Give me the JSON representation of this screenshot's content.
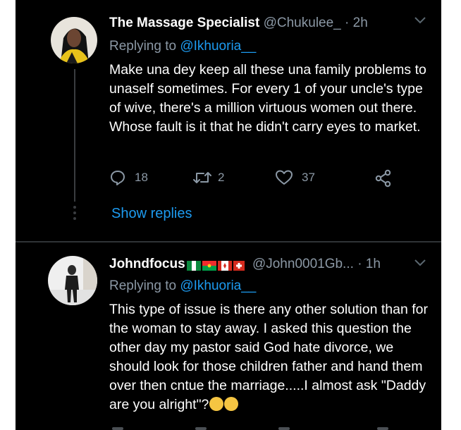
{
  "tweets": [
    {
      "display_name": "The Massage Specialist",
      "handle": "@Chukulee_",
      "time": "· 2h",
      "replying_prefix": "Replying to",
      "replying_to": "@Ikhuoria__",
      "text": "Make una dey keep all these una family problems to unaself sometimes. For every 1 of your uncle's type of wive, there's a million virtuous women out there. Whose fault is it that he didn't carry eyes to market.",
      "replies": "18",
      "retweets": "2",
      "likes": "37",
      "show_replies": "Show replies"
    },
    {
      "display_name": "Johndfocus",
      "handle": "@John0001Gb...",
      "time": "· 1h",
      "replying_prefix": "Replying to",
      "replying_to": "@Ikhuoria__",
      "text": "This type of issue is there any other solution than for the woman to stay away. I asked this question the other day my pastor said God hate divorce, we should look for those children father and hand them over then cntue the marriage.....I almost ask \"Daddy are you alright\"?"
    }
  ],
  "colors": {
    "background": "#000000",
    "accent": "#1d9bf0",
    "secondary_text": "#8b98a5"
  }
}
